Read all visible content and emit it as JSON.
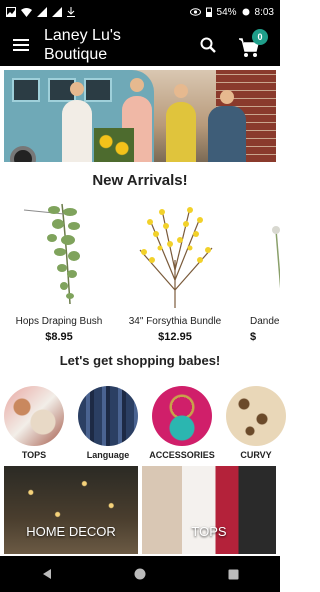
{
  "status_bar": {
    "battery": "54%",
    "time": "8:03"
  },
  "app_bar": {
    "title": "Laney Lu's Boutique",
    "cart_count": "0"
  },
  "new_arrivals": {
    "title": "New Arrivals!",
    "products": [
      {
        "name": "Hops Draping Bush",
        "price": "$8.95"
      },
      {
        "name": "34\" Forsythia Bundle",
        "price": "$12.95"
      },
      {
        "name": "Dande",
        "price": "$"
      }
    ]
  },
  "shopping": {
    "title": "Let's get shopping babes!",
    "categories": [
      {
        "label": "TOPS"
      },
      {
        "label": "Language"
      },
      {
        "label": "ACCESSORIES"
      },
      {
        "label": "CURVY"
      }
    ]
  },
  "tiles": [
    {
      "label": "HOME DECOR"
    },
    {
      "label": "TOPS"
    }
  ],
  "colors": {
    "bar_background": "#000000",
    "badge": "#1f9e8a"
  }
}
